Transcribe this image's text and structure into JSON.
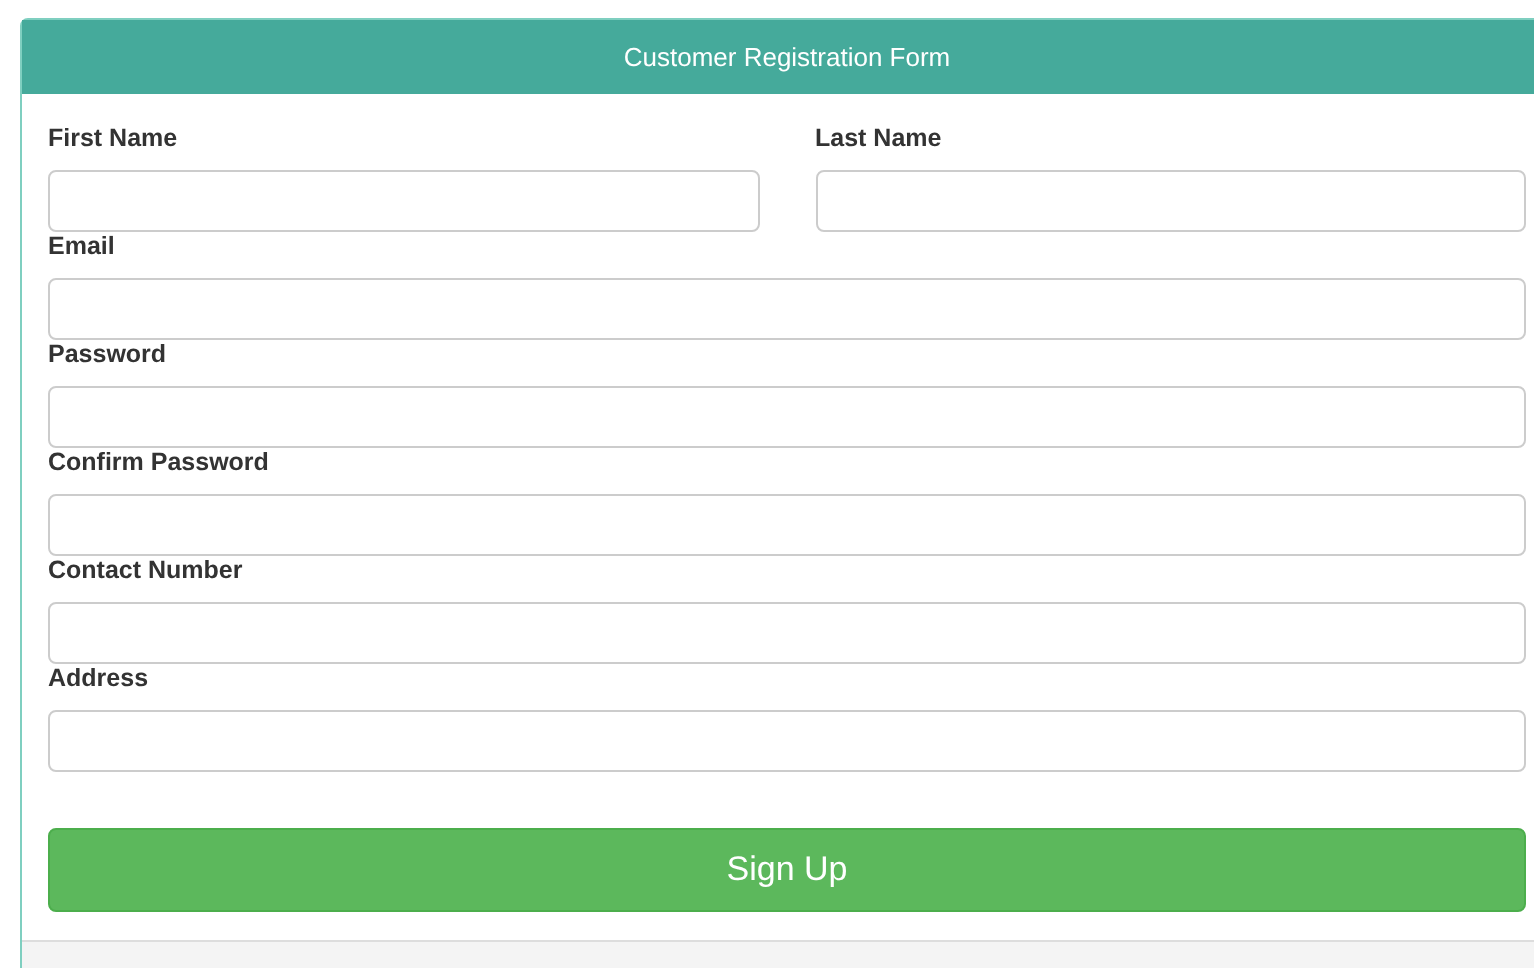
{
  "form": {
    "title": "Customer Registration Form",
    "rows": [
      {
        "fields": [
          {
            "label": "First Name"
          },
          {
            "label": "Last Name"
          }
        ]
      },
      {
        "fields": [
          {
            "label": "Email"
          }
        ]
      },
      {
        "fields": [
          {
            "label": "Password"
          }
        ]
      },
      {
        "fields": [
          {
            "label": "Confirm Password"
          }
        ]
      },
      {
        "fields": [
          {
            "label": "Contact Number"
          }
        ]
      },
      {
        "fields": [
          {
            "label": "Address"
          }
        ]
      }
    ],
    "submit": "Sign Up"
  }
}
